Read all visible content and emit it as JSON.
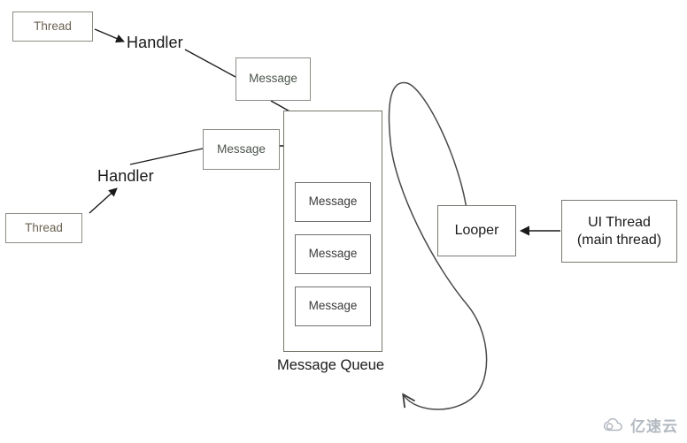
{
  "diagram": {
    "title": "Android Handler / MessageQueue / Looper diagram",
    "colors": {
      "background": "#ffffff",
      "thread_box_border": "#8c8c84",
      "thread_text": "#6b6152",
      "message_box_border": "#8a8d85",
      "message_text": "#4c544c",
      "queue_border": "#76786f",
      "plain_text": "#1a1a1a",
      "arrow": "#1a1a1a",
      "loop_stroke": "#4a4a4a",
      "watermark": "#9aa2ad"
    },
    "nodes": {
      "thread_top": {
        "label": "Thread"
      },
      "thread_bottom": {
        "label": "Thread"
      },
      "handler_top": {
        "label": "Handler"
      },
      "handler_bottom": {
        "label": "Handler"
      },
      "message_top": {
        "label": "Message"
      },
      "message_middle": {
        "label": "Message"
      },
      "queue_message_1": {
        "label": "Message"
      },
      "queue_message_2": {
        "label": "Message"
      },
      "queue_message_3": {
        "label": "Message"
      },
      "message_queue_label": {
        "label": "Message Queue"
      },
      "looper": {
        "label": "Looper"
      },
      "ui_thread": {
        "line1": "UI Thread",
        "line2": "(main thread)"
      }
    },
    "watermark": {
      "text": "亿速云",
      "icon": "cloud-icon"
    }
  }
}
